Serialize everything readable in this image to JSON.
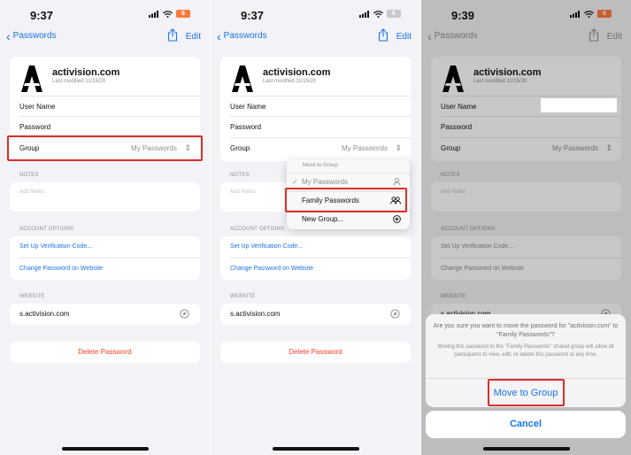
{
  "status": {
    "time1": "9:37",
    "time2": "9:37",
    "time3": "9:39",
    "battery": "6"
  },
  "nav": {
    "back": "Passwords",
    "edit": "Edit"
  },
  "entry": {
    "site": "activision.com",
    "modified": "Last modified 11/15/20",
    "user_name_label": "User Name",
    "password_label": "Password",
    "group_label": "Group",
    "group_value": "My Passwords"
  },
  "notes": {
    "header": "NOTES",
    "placeholder": "Add Notes"
  },
  "account_options": {
    "header": "ACCOUNT OPTIONS",
    "verification": "Set Up Verification Code...",
    "change_password": "Change Password on Website"
  },
  "website": {
    "header": "WEBSITE",
    "url": "s.activision.com"
  },
  "delete_label": "Delete Password",
  "menu": {
    "title": "Move to Group",
    "items": [
      {
        "label": "My Passwords",
        "checked": true
      },
      {
        "label": "Family Passwords"
      },
      {
        "label": "New Group..."
      }
    ]
  },
  "alert": {
    "title": "Are you sure you want to move the password for \"activision.com\" to \"Family Passwords\"?",
    "body": "Moving this password to the \"Family Passwords\" shared group will allow all participants to view, edit, or delete this password at any time.",
    "confirm": "Move to Group",
    "cancel": "Cancel"
  },
  "colors": {
    "accent": "#1a73e8",
    "destructive": "#ff3b30",
    "highlight": "#d93025"
  }
}
